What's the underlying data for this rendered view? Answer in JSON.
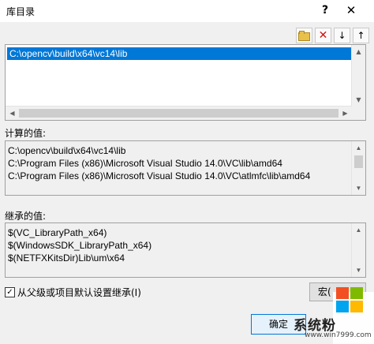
{
  "window": {
    "title": "库目录",
    "help_label": "?",
    "close_label": "✕"
  },
  "toolbar": {
    "icons": [
      "new-folder-icon",
      "delete-icon",
      "move-down-icon",
      "move-up-icon"
    ],
    "delete_glyph": "✕",
    "down_glyph": "↓",
    "up_glyph": "↑"
  },
  "editor": {
    "selected_entry": "C:\\opencv\\build\\x64\\vc14\\lib"
  },
  "computed": {
    "label": "计算的值:",
    "lines": [
      "C:\\opencv\\build\\x64\\vc14\\lib",
      "C:\\Program Files (x86)\\Microsoft Visual Studio 14.0\\VC\\lib\\amd64",
      "C:\\Program Files (x86)\\Microsoft Visual Studio 14.0\\VC\\atlmfc\\lib\\amd64"
    ]
  },
  "inherited": {
    "label": "继承的值:",
    "lines": [
      "$(VC_LibraryPath_x64)",
      "$(WindowsSDK_LibraryPath_x64)",
      "$(NETFXKitsDir)Lib\\um\\x64"
    ]
  },
  "inherit_checkbox": {
    "label": "从父级或项目默认设置继承(I)",
    "checked": true,
    "mark": "✓"
  },
  "buttons": {
    "macro_label": "宏(",
    "ok_label": "确定"
  },
  "watermark": {
    "brand": "系统粉",
    "url": "www.win7999.com",
    "colors": [
      "#f25022",
      "#7fba00",
      "#00a4ef",
      "#ffb900"
    ]
  }
}
